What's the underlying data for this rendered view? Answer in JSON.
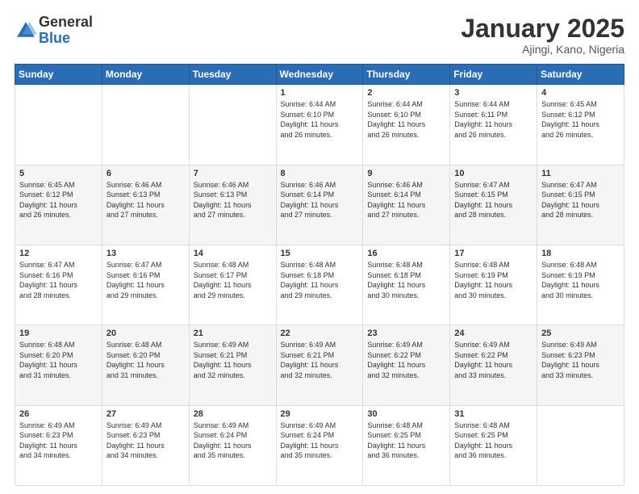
{
  "header": {
    "logo_general": "General",
    "logo_blue": "Blue",
    "main_title": "January 2025",
    "sub_title": "Ajingi, Kano, Nigeria"
  },
  "days_of_week": [
    "Sunday",
    "Monday",
    "Tuesday",
    "Wednesday",
    "Thursday",
    "Friday",
    "Saturday"
  ],
  "weeks": [
    [
      {
        "day": "",
        "info": ""
      },
      {
        "day": "",
        "info": ""
      },
      {
        "day": "",
        "info": ""
      },
      {
        "day": "1",
        "info": "Sunrise: 6:44 AM\nSunset: 6:10 PM\nDaylight: 11 hours\nand 26 minutes."
      },
      {
        "day": "2",
        "info": "Sunrise: 6:44 AM\nSunset: 6:10 PM\nDaylight: 11 hours\nand 26 minutes."
      },
      {
        "day": "3",
        "info": "Sunrise: 6:44 AM\nSunset: 6:11 PM\nDaylight: 11 hours\nand 26 minutes."
      },
      {
        "day": "4",
        "info": "Sunrise: 6:45 AM\nSunset: 6:12 PM\nDaylight: 11 hours\nand 26 minutes."
      }
    ],
    [
      {
        "day": "5",
        "info": "Sunrise: 6:45 AM\nSunset: 6:12 PM\nDaylight: 11 hours\nand 26 minutes."
      },
      {
        "day": "6",
        "info": "Sunrise: 6:46 AM\nSunset: 6:13 PM\nDaylight: 11 hours\nand 27 minutes."
      },
      {
        "day": "7",
        "info": "Sunrise: 6:46 AM\nSunset: 6:13 PM\nDaylight: 11 hours\nand 27 minutes."
      },
      {
        "day": "8",
        "info": "Sunrise: 6:46 AM\nSunset: 6:14 PM\nDaylight: 11 hours\nand 27 minutes."
      },
      {
        "day": "9",
        "info": "Sunrise: 6:46 AM\nSunset: 6:14 PM\nDaylight: 11 hours\nand 27 minutes."
      },
      {
        "day": "10",
        "info": "Sunrise: 6:47 AM\nSunset: 6:15 PM\nDaylight: 11 hours\nand 28 minutes."
      },
      {
        "day": "11",
        "info": "Sunrise: 6:47 AM\nSunset: 6:15 PM\nDaylight: 11 hours\nand 28 minutes."
      }
    ],
    [
      {
        "day": "12",
        "info": "Sunrise: 6:47 AM\nSunset: 6:16 PM\nDaylight: 11 hours\nand 28 minutes."
      },
      {
        "day": "13",
        "info": "Sunrise: 6:47 AM\nSunset: 6:16 PM\nDaylight: 11 hours\nand 29 minutes."
      },
      {
        "day": "14",
        "info": "Sunrise: 6:48 AM\nSunset: 6:17 PM\nDaylight: 11 hours\nand 29 minutes."
      },
      {
        "day": "15",
        "info": "Sunrise: 6:48 AM\nSunset: 6:18 PM\nDaylight: 11 hours\nand 29 minutes."
      },
      {
        "day": "16",
        "info": "Sunrise: 6:48 AM\nSunset: 6:18 PM\nDaylight: 11 hours\nand 30 minutes."
      },
      {
        "day": "17",
        "info": "Sunrise: 6:48 AM\nSunset: 6:19 PM\nDaylight: 11 hours\nand 30 minutes."
      },
      {
        "day": "18",
        "info": "Sunrise: 6:48 AM\nSunset: 6:19 PM\nDaylight: 11 hours\nand 30 minutes."
      }
    ],
    [
      {
        "day": "19",
        "info": "Sunrise: 6:48 AM\nSunset: 6:20 PM\nDaylight: 11 hours\nand 31 minutes."
      },
      {
        "day": "20",
        "info": "Sunrise: 6:48 AM\nSunset: 6:20 PM\nDaylight: 11 hours\nand 31 minutes."
      },
      {
        "day": "21",
        "info": "Sunrise: 6:49 AM\nSunset: 6:21 PM\nDaylight: 11 hours\nand 32 minutes."
      },
      {
        "day": "22",
        "info": "Sunrise: 6:49 AM\nSunset: 6:21 PM\nDaylight: 11 hours\nand 32 minutes."
      },
      {
        "day": "23",
        "info": "Sunrise: 6:49 AM\nSunset: 6:22 PM\nDaylight: 11 hours\nand 32 minutes."
      },
      {
        "day": "24",
        "info": "Sunrise: 6:49 AM\nSunset: 6:22 PM\nDaylight: 11 hours\nand 33 minutes."
      },
      {
        "day": "25",
        "info": "Sunrise: 6:49 AM\nSunset: 6:23 PM\nDaylight: 11 hours\nand 33 minutes."
      }
    ],
    [
      {
        "day": "26",
        "info": "Sunrise: 6:49 AM\nSunset: 6:23 PM\nDaylight: 11 hours\nand 34 minutes."
      },
      {
        "day": "27",
        "info": "Sunrise: 6:49 AM\nSunset: 6:23 PM\nDaylight: 11 hours\nand 34 minutes."
      },
      {
        "day": "28",
        "info": "Sunrise: 6:49 AM\nSunset: 6:24 PM\nDaylight: 11 hours\nand 35 minutes."
      },
      {
        "day": "29",
        "info": "Sunrise: 6:49 AM\nSunset: 6:24 PM\nDaylight: 11 hours\nand 35 minutes."
      },
      {
        "day": "30",
        "info": "Sunrise: 6:48 AM\nSunset: 6:25 PM\nDaylight: 11 hours\nand 36 minutes."
      },
      {
        "day": "31",
        "info": "Sunrise: 6:48 AM\nSunset: 6:25 PM\nDaylight: 11 hours\nand 36 minutes."
      },
      {
        "day": "",
        "info": ""
      }
    ]
  ]
}
